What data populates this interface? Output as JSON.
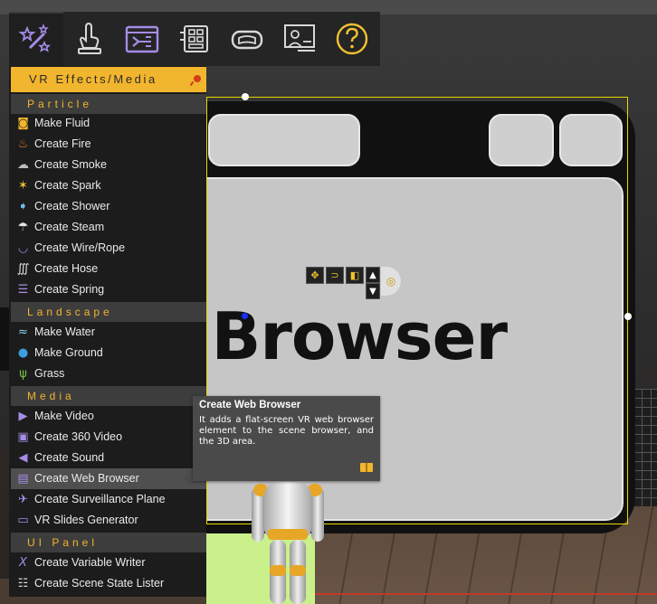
{
  "toolbar": {
    "buttons": [
      {
        "name": "vr-effects-media-tool",
        "icon": "magic-wand-stars-icon",
        "active": true
      },
      {
        "name": "touch-interaction-tool",
        "icon": "hand-pointer-icon",
        "active": false
      },
      {
        "name": "logic-flow-tool",
        "icon": "flow-board-icon",
        "active": false
      },
      {
        "name": "grid-layout-tool",
        "icon": "grid-panel-icon",
        "active": false
      },
      {
        "name": "vr-headset-tool",
        "icon": "vr-headset-icon",
        "active": false
      },
      {
        "name": "presenter-screen-tool",
        "icon": "presenter-screen-icon",
        "active": false
      },
      {
        "name": "help-tool",
        "icon": "question-circle-icon",
        "active": false
      }
    ],
    "accent_color": "#f2b52e"
  },
  "panel": {
    "title": "VR Effects/Media",
    "sections": [
      {
        "label": "Particle",
        "items": [
          {
            "label": "Make Fluid",
            "icon": "fluid-glass-icon"
          },
          {
            "label": "Create Fire",
            "icon": "fire-icon"
          },
          {
            "label": "Create Smoke",
            "icon": "smoke-icon"
          },
          {
            "label": "Create Spark",
            "icon": "spark-icon"
          },
          {
            "label": "Create Shower",
            "icon": "shower-icon"
          },
          {
            "label": "Create Steam",
            "icon": "steam-cloud-icon"
          },
          {
            "label": "Create Wire/Rope",
            "icon": "rope-icon"
          },
          {
            "label": "Create Hose",
            "icon": "hose-icon"
          },
          {
            "label": "Create Spring",
            "icon": "spring-icon"
          }
        ]
      },
      {
        "label": "Landscape",
        "items": [
          {
            "label": "Make Water",
            "icon": "water-icon"
          },
          {
            "label": "Make Ground",
            "icon": "globe-icon"
          },
          {
            "label": "Grass",
            "icon": "grass-icon"
          }
        ]
      },
      {
        "label": "Media",
        "items": [
          {
            "label": "Make Video",
            "icon": "video-icon"
          },
          {
            "label": "Create 360 Video",
            "icon": "video-360-icon"
          },
          {
            "label": "Create Sound",
            "icon": "speaker-icon"
          },
          {
            "label": "Create Web Browser",
            "icon": "browser-window-icon",
            "selected": true
          },
          {
            "label": "Create Surveillance Plane",
            "icon": "camera-plane-icon"
          },
          {
            "label": "VR Slides Generator",
            "icon": "slides-icon"
          }
        ]
      },
      {
        "label": "UI Panel",
        "items": [
          {
            "label": "Create Variable Writer",
            "icon": "variable-x-icon"
          },
          {
            "label": "Create Scene State Lister",
            "icon": "list-icon"
          }
        ]
      }
    ]
  },
  "tooltip": {
    "title": "Create Web Browser",
    "body": "It adds a flat-screen VR web browser element to the scene browser, and the 3D area."
  },
  "scene": {
    "browser_word": "Browser",
    "selection_color": "#e8d800"
  }
}
